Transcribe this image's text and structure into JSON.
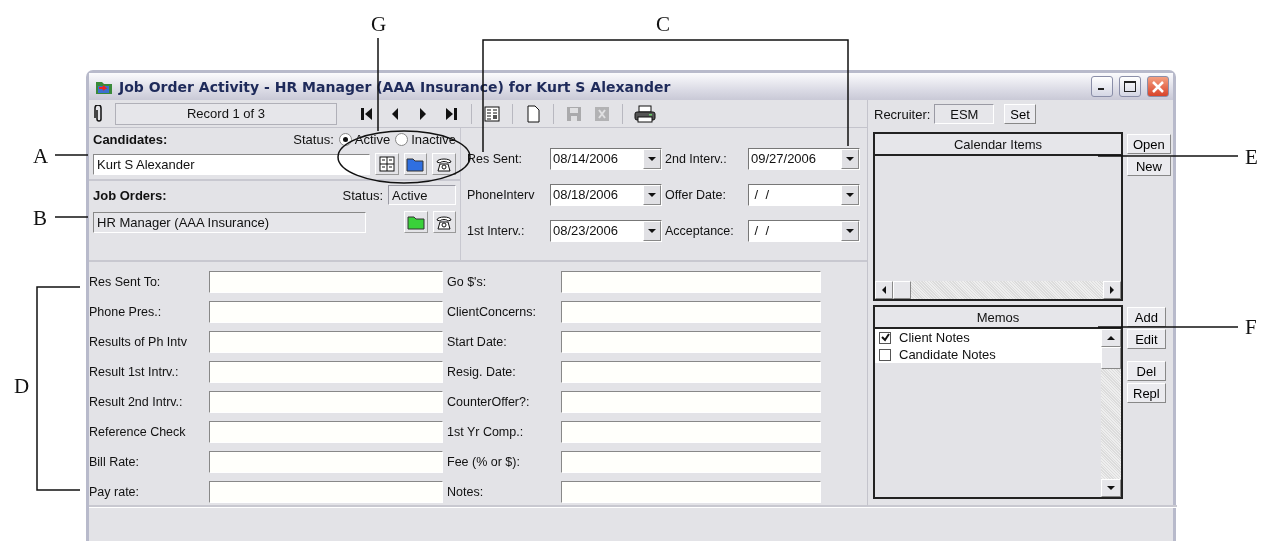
{
  "window": {
    "title": "Job Order Activity - HR Manager (AAA Insurance) for Kurt S Alexander"
  },
  "toolbar": {
    "record": "Record 1 of 3",
    "buttons": [
      {
        "kind": "first",
        "disabled": false
      },
      {
        "kind": "prev",
        "disabled": false
      },
      {
        "kind": "next",
        "disabled": false
      },
      {
        "kind": "last",
        "disabled": false
      },
      {
        "kind": "sep"
      },
      {
        "kind": "form",
        "disabled": false
      },
      {
        "kind": "sep"
      },
      {
        "kind": "new",
        "disabled": false
      },
      {
        "kind": "sep"
      },
      {
        "kind": "save",
        "disabled": true
      },
      {
        "kind": "delete",
        "disabled": true
      },
      {
        "kind": "sep"
      },
      {
        "kind": "print",
        "disabled": false
      }
    ]
  },
  "recruiter": {
    "label": "Recruiter:",
    "value": "ESM",
    "button": "Set"
  },
  "candidates": {
    "label": "Candidates:",
    "status_label": "Status:",
    "options": [
      {
        "label": "Active",
        "selected": true
      },
      {
        "label": "Inactive",
        "selected": false
      }
    ],
    "name": "Kurt S Alexander",
    "disabled": false
  },
  "job_orders": {
    "label": "Job Orders:",
    "status_label": "Status:",
    "status": "Active",
    "name": "HR Manager (AAA Insurance)",
    "disabled": true
  },
  "dates": [
    {
      "label": "Res Sent:",
      "value": "08/14/2006"
    },
    {
      "label": "2nd Interv.:",
      "value": "09/27/2006"
    },
    {
      "label": "PhoneInterv",
      "value": "08/18/2006"
    },
    {
      "label": "Offer Date:",
      "value": " /  /"
    },
    {
      "label": "1st Interv.:",
      "value": "08/23/2006"
    },
    {
      "label": "Acceptance:",
      "value": " /  /"
    }
  ],
  "fields": [
    {
      "label": "Res Sent To:"
    },
    {
      "label": "Go $'s:"
    },
    {
      "label": "Phone Pres.:"
    },
    {
      "label": "ClientConcerns:"
    },
    {
      "label": "Results of Ph Intv"
    },
    {
      "label": "Start Date:"
    },
    {
      "label": "Result 1st Intrv.:"
    },
    {
      "label": "Resig. Date:"
    },
    {
      "label": "Result 2nd Intrv.:"
    },
    {
      "label": "CounterOffer?:"
    },
    {
      "label": "Reference Check"
    },
    {
      "label": "1st Yr Comp.:"
    },
    {
      "label": "Bill Rate:"
    },
    {
      "label": "Fee (% or $):"
    },
    {
      "label": "Pay rate:"
    },
    {
      "label": "Notes:"
    }
  ],
  "calendar": {
    "title": "Calendar Items",
    "buttons": [
      "Open",
      "New"
    ]
  },
  "memos": {
    "title": "Memos",
    "items": [
      {
        "label": "Client Notes",
        "checked": true
      },
      {
        "label": "Candidate Notes",
        "checked": false
      }
    ],
    "buttons": [
      "Add",
      "Edit",
      "Del",
      "Repl"
    ]
  },
  "callouts": [
    "G",
    "C",
    "A",
    "E",
    "B",
    "F",
    "D"
  ]
}
